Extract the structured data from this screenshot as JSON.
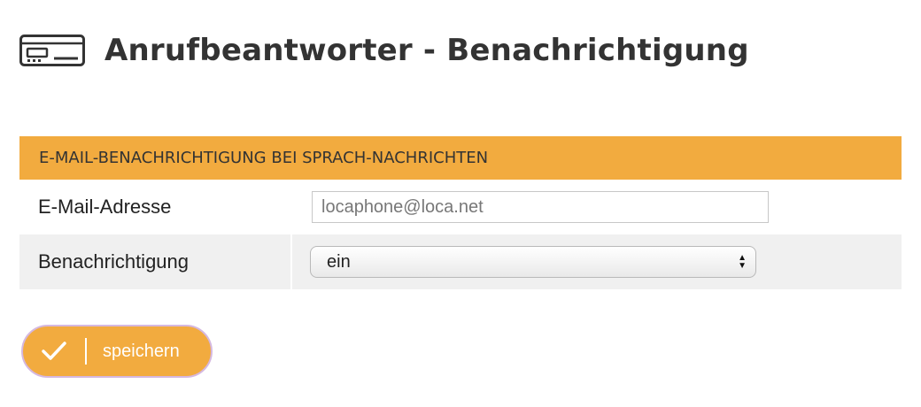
{
  "header": {
    "icon": "answering-machine-icon",
    "title": "Anrufbeantworter - Benachrichtigung"
  },
  "panel": {
    "title": "E-MAIL-BENACHRICHTIGUNG BEI SPRACH-NACHRICHTEN",
    "accent_color": "#f2ab3f",
    "rows": [
      {
        "label": "E-Mail-Adresse",
        "type": "text-input",
        "value": "locaphone@loca.net"
      },
      {
        "label": "Benachrichtigung",
        "type": "select",
        "value": "ein"
      }
    ]
  },
  "actions": {
    "save_icon": "checkmark-icon",
    "save_label": "speichern"
  }
}
